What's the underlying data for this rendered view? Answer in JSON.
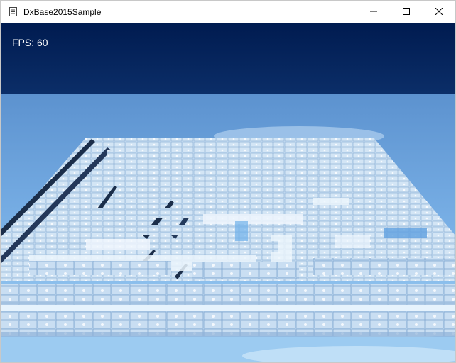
{
  "window": {
    "title": "DxBase2015Sample",
    "icons": {
      "app": "document-icon",
      "minimize": "minimize-icon",
      "maximize": "maximize-icon",
      "close": "close-icon"
    }
  },
  "overlay": {
    "fps_text": "FPS: 60"
  },
  "scene": {
    "description_colors": {
      "sky_top": "#001c52",
      "sky_bottom": "#0a2d66",
      "floor_far": "#5f95d0",
      "floor_near": "#8ec6f2",
      "block": "#bcd6ee",
      "block_edge": "#6f9ac8",
      "wall_shadow": "#1b2e4a"
    }
  }
}
